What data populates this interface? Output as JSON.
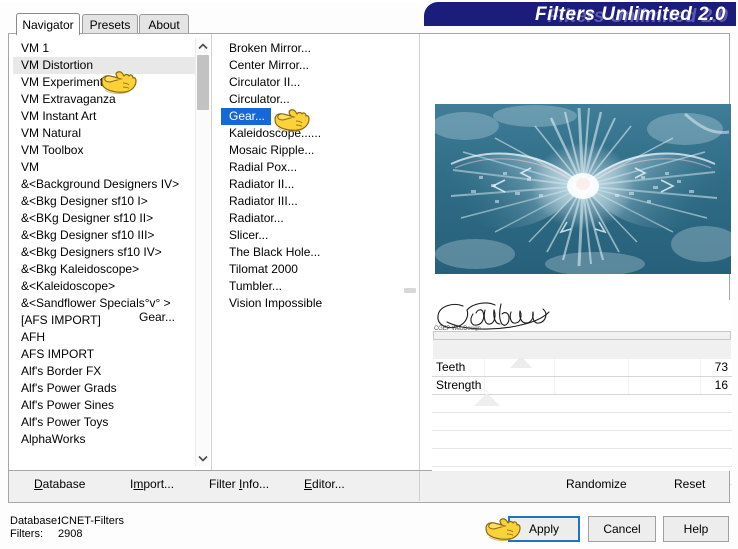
{
  "window": {
    "title": "Filters Unlimited 2.0"
  },
  "tabs": [
    {
      "label": "Navigator",
      "active": true
    },
    {
      "label": "Presets",
      "active": false
    },
    {
      "label": "About",
      "active": false
    }
  ],
  "category_list": {
    "selected": "VM Distortion",
    "items": [
      "VM 1",
      "VM Distortion",
      "VM Experimental",
      "VM Extravaganza",
      "VM Instant Art",
      "VM Natural",
      "VM Toolbox",
      "VM",
      "&<Background Designers IV>",
      "&<Bkg Designer sf10 I>",
      "&<BKg Designer sf10 II>",
      "&<Bkg Designer sf10 III>",
      "&<Bkg Designers sf10 IV>",
      "&<Bkg Kaleidoscope>",
      "&<Kaleidoscope>",
      "&<Sandflower Specials°v° >",
      "[AFS IMPORT]",
      "AFH",
      "AFS IMPORT",
      "Alf's Border FX",
      "Alf's Power Grads",
      "Alf's Power Sines",
      "Alf's Power Toys",
      "AlphaWorks"
    ]
  },
  "filter_list": {
    "selected": "Gear...",
    "items": [
      "Broken Mirror...",
      "Center Mirror...",
      "Circulator II...",
      "Circulator...",
      "Gear...",
      "Kaleidoscope......",
      "Mosaic Ripple...",
      "Radial Pox...",
      "Radiator II...",
      "Radiator III...",
      "Radiator...",
      "Slicer...",
      "The Black Hole...",
      "Tilomat 2000",
      "Tumbler...",
      "Vision Impossible"
    ]
  },
  "preview": {
    "filter_name": "Gear...",
    "signature": "Claudia",
    "signature_sub": "CGEP WebDesign"
  },
  "parameters": [
    {
      "name": "Teeth",
      "value": "73"
    },
    {
      "name": "Strength",
      "value": "16"
    }
  ],
  "toolbar": {
    "database": "Database",
    "import": "Import...",
    "filter_info": "Filter Info...",
    "editor": "Editor...",
    "randomize": "Randomize",
    "reset": "Reset"
  },
  "status": {
    "database_label": "Database:",
    "database_value": "ICNET-Filters",
    "filters_label": "Filters:",
    "filters_value": "2908"
  },
  "dialog_buttons": {
    "apply": "Apply",
    "cancel": "Cancel",
    "help": "Help"
  },
  "icons": {
    "scroll_up": "scroll-up-arrow-icon",
    "scroll_down": "scroll-down-arrow-icon",
    "hand_pointer": "hand-pointer-icon"
  },
  "colors": {
    "banner": "#1c1c7a",
    "selection_blue": "#1569d6",
    "selection_gray": "#e8e8e8",
    "focus_border": "#1a74c7"
  }
}
